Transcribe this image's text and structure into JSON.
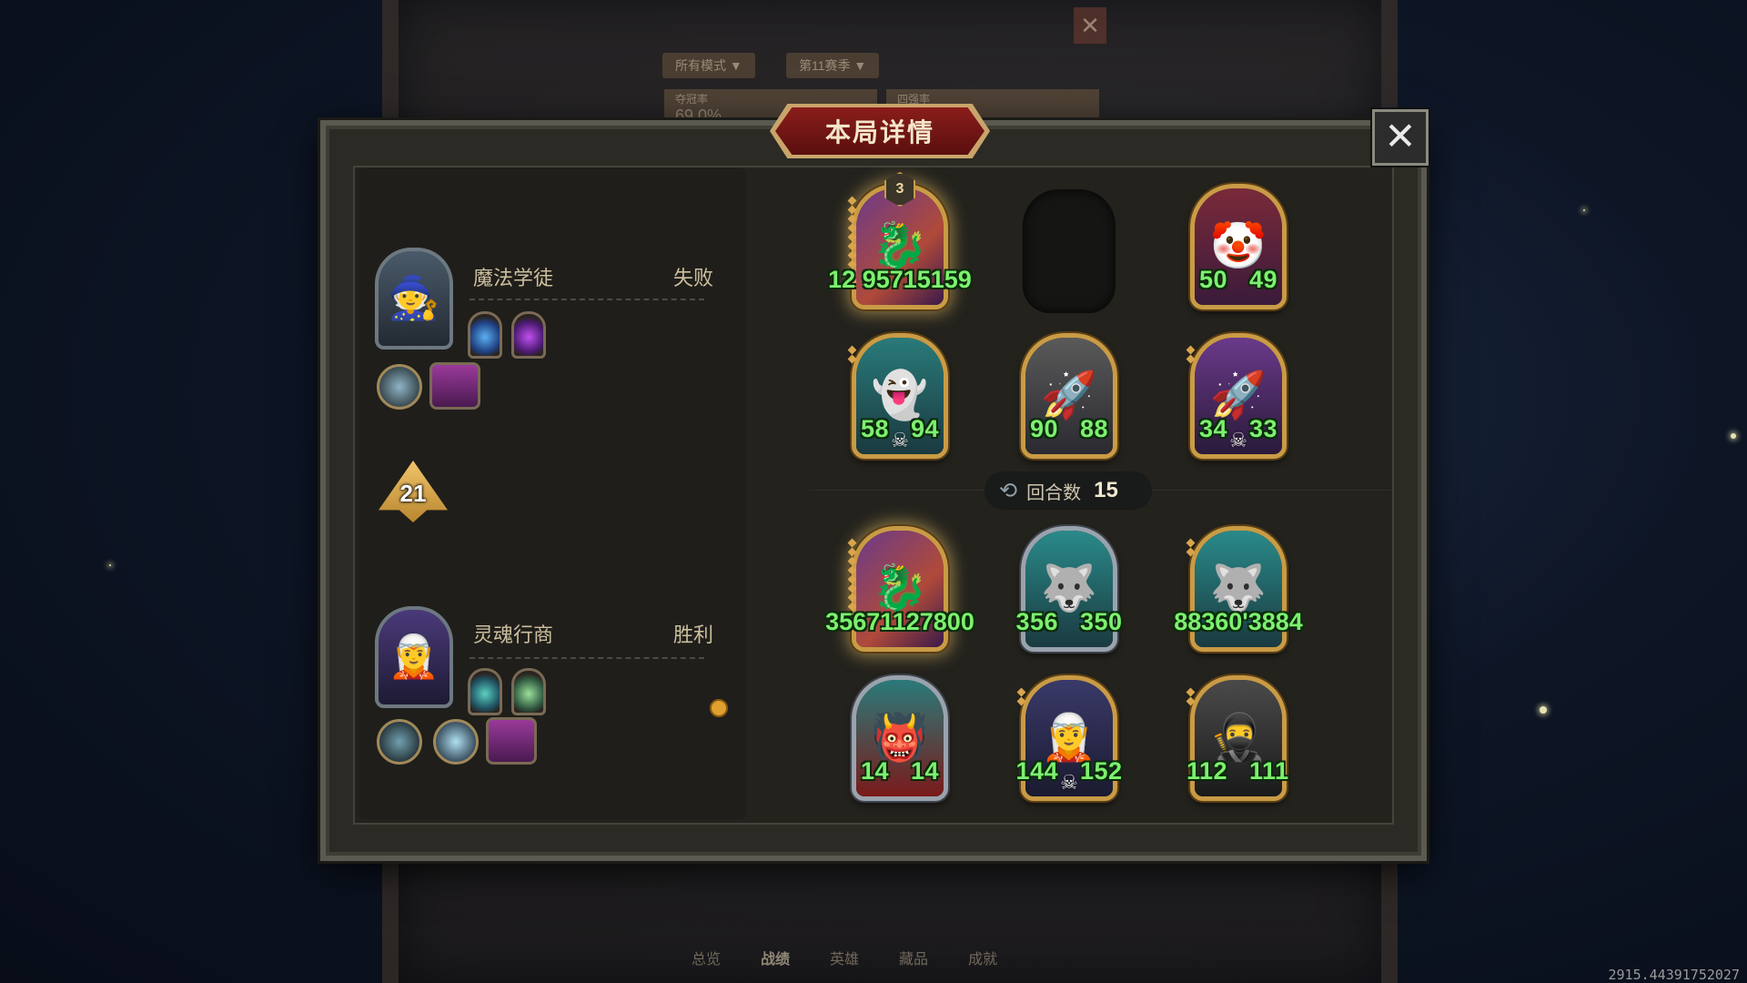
{
  "background": {
    "mode_filter": "所有模式 ▼",
    "season_filter": "第11赛季 ▼",
    "stats": [
      {
        "label": "夺冠率",
        "value": "69.0%"
      },
      {
        "label": "四强率",
        "value": "…%"
      }
    ],
    "nav": [
      "总览",
      "战绩",
      "英雄",
      "藏品",
      "成就"
    ],
    "nav_active": 1,
    "close_label": "✕"
  },
  "dialog": {
    "title": "本局详情",
    "close_label": "✕"
  },
  "players": [
    {
      "name": "魔法学徒",
      "result": "失败",
      "portrait_icon": "witch-portrait"
    },
    {
      "name": "灵魂行商",
      "result": "胜利",
      "portrait_icon": "soul-merchant-portrait"
    }
  ],
  "rank": "21",
  "round": {
    "label": "回合数",
    "value": "15"
  },
  "opponent_board": [
    {
      "name": "dragon-card",
      "atk": "12",
      "hp": "95715159",
      "stat_text": "12 95715159",
      "tier": "3",
      "icon": "dragon-claw-icon"
    },
    {
      "name": "empty-slot"
    },
    {
      "name": "jester-card",
      "atk": "50",
      "hp": "49",
      "icon": "jester-icon"
    },
    {
      "name": "ghost-lady-card",
      "atk": "58",
      "hp": "94",
      "icon": "ghost-lady-icon"
    },
    {
      "name": "airship-card",
      "atk": "90",
      "hp": "88",
      "icon": "airship-icon"
    },
    {
      "name": "airship-purple-card",
      "atk": "34",
      "hp": "33",
      "icon": "airship-icon"
    }
  ],
  "player_board": [
    {
      "name": "dragon-card",
      "atk": "3567",
      "hp": "1127800",
      "stat_text": "35671127800",
      "icon": "dragon-claw-icon"
    },
    {
      "name": "spectral-wolf-card",
      "atk": "356",
      "hp": "350",
      "icon": "spectral-wolf-icon"
    },
    {
      "name": "spectral-wolf-gold-card",
      "atk": "88360",
      "hp": "3884",
      "stat_text": "88360'3884",
      "icon": "spectral-wolf-icon"
    },
    {
      "name": "ghost-rider-card",
      "atk": "14",
      "hp": "14",
      "icon": "ghost-rider-icon"
    },
    {
      "name": "night-elf-card",
      "atk": "144",
      "hp": "152",
      "icon": "night-elf-icon"
    },
    {
      "name": "hooded-rogue-card",
      "atk": "112",
      "hp": "111",
      "icon": "hooded-rogue-icon"
    }
  ],
  "footer_coords": "2915.44391752027",
  "colors": {
    "stat_green": "#7df06f",
    "card_gold": "#c99b45",
    "title_red": "#8a1d1b"
  }
}
